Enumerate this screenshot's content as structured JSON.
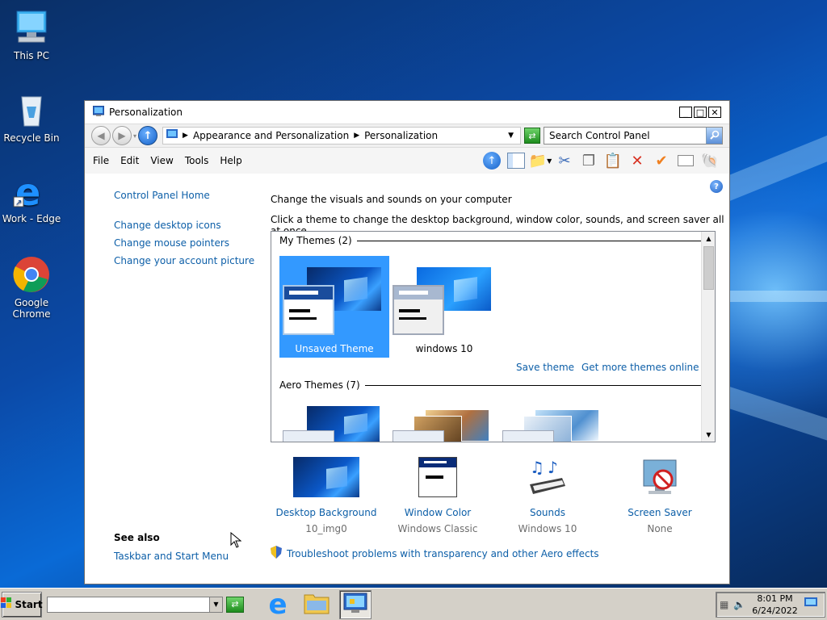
{
  "desktop": {
    "icons": [
      {
        "label": "This PC"
      },
      {
        "label": "Recycle Bin"
      },
      {
        "label": "Work - Edge"
      },
      {
        "label": "Google Chrome"
      }
    ]
  },
  "window": {
    "title": "Personalization",
    "breadcrumb": [
      "Appearance and Personalization",
      "Personalization"
    ],
    "search_placeholder": "Search Control Panel",
    "menu": [
      "File",
      "Edit",
      "View",
      "Tools",
      "Help"
    ]
  },
  "left_pane": {
    "home": "Control Panel Home",
    "links": [
      "Change desktop icons",
      "Change mouse pointers",
      "Change your account picture"
    ],
    "see_also_title": "See also",
    "see_also_links": [
      "Taskbar and Start Menu"
    ]
  },
  "main": {
    "heading": "Change the visuals and sounds on your computer",
    "subheading": "Click a theme to change the desktop background, window color, sounds, and screen saver all at once.",
    "my_themes_header": "My Themes (2)",
    "themes": [
      {
        "label": "Unsaved Theme",
        "selected": true
      },
      {
        "label": "windows 10",
        "selected": false
      }
    ],
    "save_theme": "Save theme",
    "more_themes": "Get more themes online",
    "aero_header": "Aero Themes (7)",
    "settings": [
      {
        "name": "Desktop Background",
        "value": "10_img0"
      },
      {
        "name": "Window Color",
        "value": "Windows Classic"
      },
      {
        "name": "Sounds",
        "value": "Windows 10"
      },
      {
        "name": "Screen Saver",
        "value": "None"
      }
    ],
    "troubleshoot": "Troubleshoot problems with transparency and other Aero effects"
  },
  "taskbar": {
    "start_label": "Start",
    "time": "8:01 PM",
    "date": "6/24/2022"
  },
  "colors": {
    "link": "#0d5fa8",
    "selection": "#3399ff"
  }
}
